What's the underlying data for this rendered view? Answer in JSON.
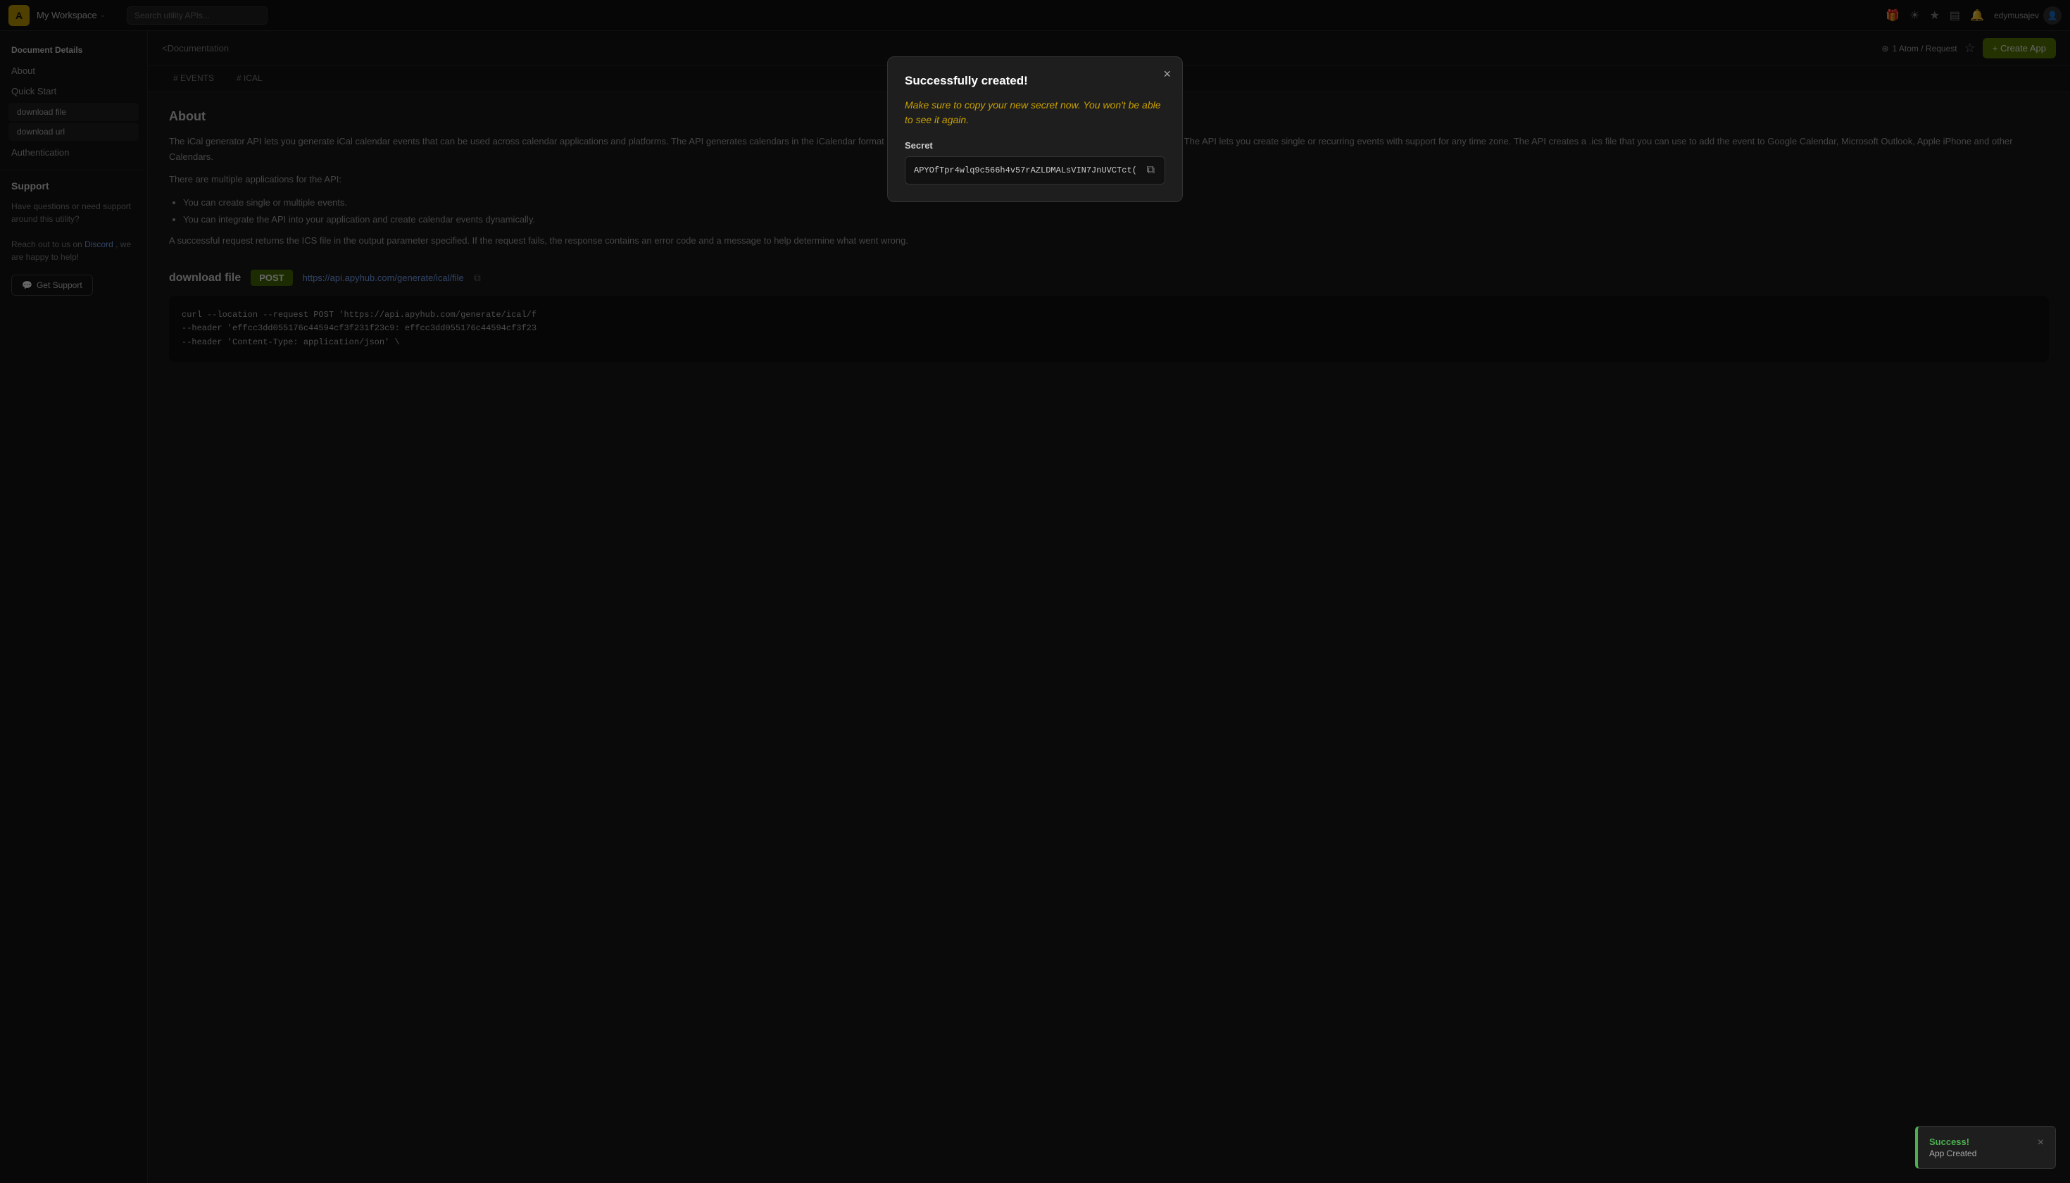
{
  "topnav": {
    "logo": "A",
    "workspace": "My Workspace",
    "chevron": "⌄",
    "search_placeholder": "Search utility APIs...",
    "icons": [
      "🎁",
      "☀",
      "★",
      "▤",
      "🔔"
    ],
    "username": "edymusajev"
  },
  "sidebar": {
    "doc_details_title": "Document Details",
    "items": [
      {
        "label": "About"
      },
      {
        "label": "Quick Start"
      }
    ],
    "subitems": [
      {
        "label": "download file"
      },
      {
        "label": "download url"
      }
    ],
    "auth_item": {
      "label": "Authentication"
    },
    "support_title": "Support",
    "support_text_before": "Have questions or need support around this utility?",
    "support_text_middle": "Reach out to us on",
    "support_link_label": "Discord",
    "support_text_after": ", we are happy to help!",
    "get_support_label": "Get Support"
  },
  "main_header": {
    "breadcrumb": "<Documentation",
    "atom_count": "1 Atom / Request",
    "star_icon": "☆",
    "create_app_label": "+ Create App"
  },
  "tabs": [
    {
      "label": "# EVENTS",
      "active": false
    },
    {
      "label": "# ICAL",
      "active": false
    }
  ],
  "content": {
    "about_heading": "About",
    "about_p1": "The iCal generator API lets you generate iCal calendar events that can be used across calendar applications and platforms. The API generates calendars in the iCalendar format (RFC 5545), a textual format that can be loaded by different applications. The API lets you create single or recurring events with support for any time zone. The API creates a .ics file that you can use to add the event to Google Calendar, Microsoft Outlook, Apple iPhone and other Calendars.",
    "about_p2": "There are multiple applications for the API:",
    "bullets": [
      "You can create single or multiple events.",
      "You can integrate the API into your application and create calendar events dynamically."
    ],
    "about_p3": "A successful request returns the ICS file in the output parameter specified. If the request fails, the response contains an error code and a message to help determine what went wrong.",
    "download_file_heading": "download file",
    "method_badge": "POST",
    "endpoint_url": "https://api.apyhub.com/generate/ical/file",
    "code_line1": "curl --location --request POST 'https://api.apyhub.com/generate/ical/f",
    "code_line2": "--header 'effcc3dd055176c44594cf3f231f23c9: effcc3dd055176c44594cf3f23",
    "code_line3": "--header 'Content-Type: application/json' \\"
  },
  "modal": {
    "title": "Successfully created!",
    "warning": "Make sure to copy your new secret now. You won't be able to see it again.",
    "secret_label": "Secret",
    "secret_value": "APYOfTpr4wlq9c566h4v57rAZLDMALsVIN7JnUVCTct(",
    "copy_icon": "⧉"
  },
  "toast": {
    "title": "Success!",
    "message": "App Created",
    "close": "×"
  }
}
